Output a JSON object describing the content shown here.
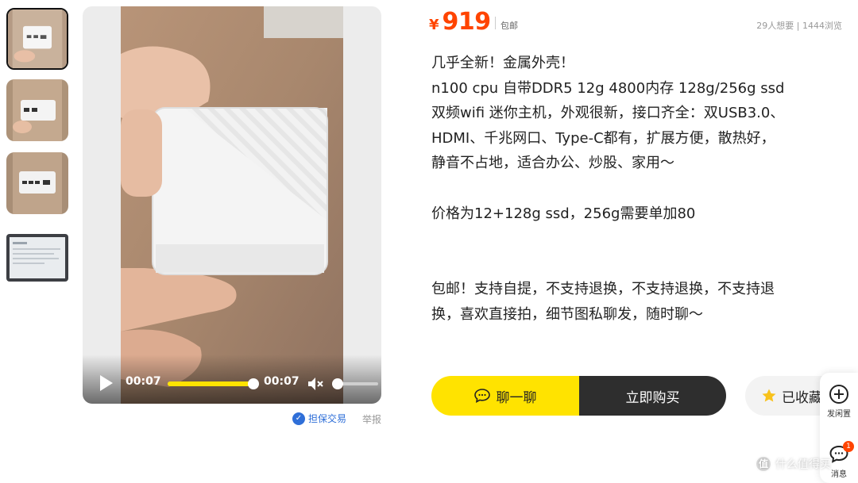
{
  "price": {
    "symbol": "¥",
    "amount": "919",
    "shipping": "包邮",
    "stats": "29人想要 | 1444浏览"
  },
  "description": {
    "lines_1": [
      "几乎全新！金属外壳！",
      "n100 cpu 自带DDR5 12g 4800内存 128g/256g ssd",
      "双频wifi 迷你主机，外观很新，接口齐全：双USB3.0、",
      "HDMI、千兆网口、Type-C都有，扩展方便，散热好，",
      "静音不占地，适合办公、炒股、家用～"
    ],
    "line_2": "价格为12+128g ssd，256g需要单加80",
    "lines_3": [
      "包邮！支持自提，不支持退换，不支持退换，不支持退",
      "换，喜欢直接拍，细节图私聊发，随时聊～"
    ]
  },
  "video": {
    "current_time": "00:07",
    "duration": "00:07",
    "progress_fraction": 1.0
  },
  "links": {
    "guarantee": "担保交易",
    "report": "举报",
    "guarantee_icon": "shield-icon"
  },
  "actions": {
    "chat": "聊一聊",
    "buy": "立即购买",
    "favorite": "已收藏"
  },
  "sidebar": {
    "publish": "发闲置",
    "messages": "消息",
    "message_badge": "1"
  },
  "watermark": {
    "text": "什么值得买",
    "logo": "值"
  },
  "colors": {
    "price": "#ff4400",
    "accent_yellow": "#ffe300",
    "buy_button": "#2e2e2e",
    "link_blue": "#2f6fd8"
  }
}
